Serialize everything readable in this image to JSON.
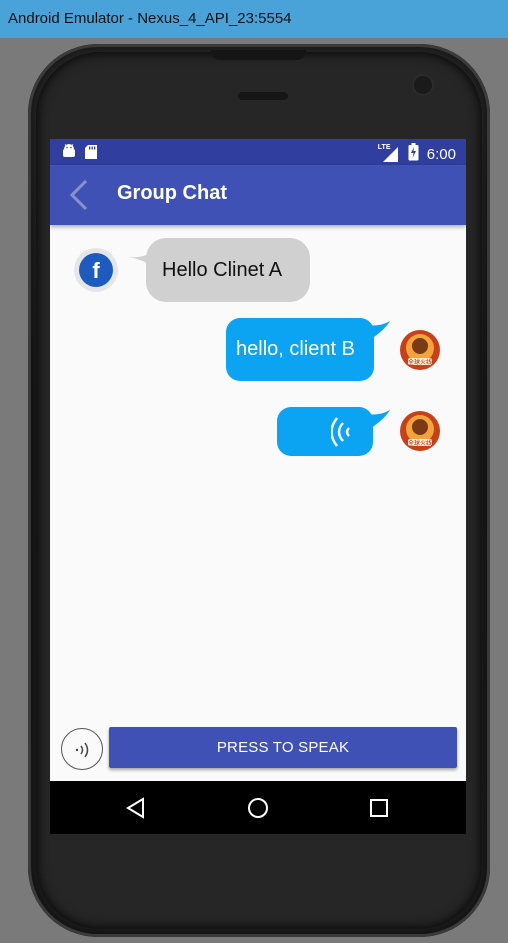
{
  "window": {
    "title": "Android Emulator - Nexus_4_API_23:5554"
  },
  "status_bar": {
    "network": "LTE",
    "time": "6:00"
  },
  "toolbar": {
    "title": "Group Chat"
  },
  "messages": [
    {
      "from": "other",
      "text": "Hello Clinet A"
    },
    {
      "from": "me",
      "text": "hello, client B"
    },
    {
      "from": "me",
      "type": "voice"
    }
  ],
  "bottom": {
    "speak_label": "PRESS TO SPEAK"
  },
  "colors": {
    "primary": "#3f51b5",
    "primary_dark": "#303f9f",
    "bubble_out": "#0aa4f2",
    "bubble_in": "#d0d0d0"
  },
  "icons": [
    "android-icon",
    "sdcard-icon",
    "signal-icon",
    "battery-icon",
    "back-arrow-icon",
    "facebook-avatar-icon",
    "game-avatar-icon",
    "voice-wave-icon",
    "nav-back-icon",
    "nav-home-icon",
    "nav-recents-icon"
  ]
}
